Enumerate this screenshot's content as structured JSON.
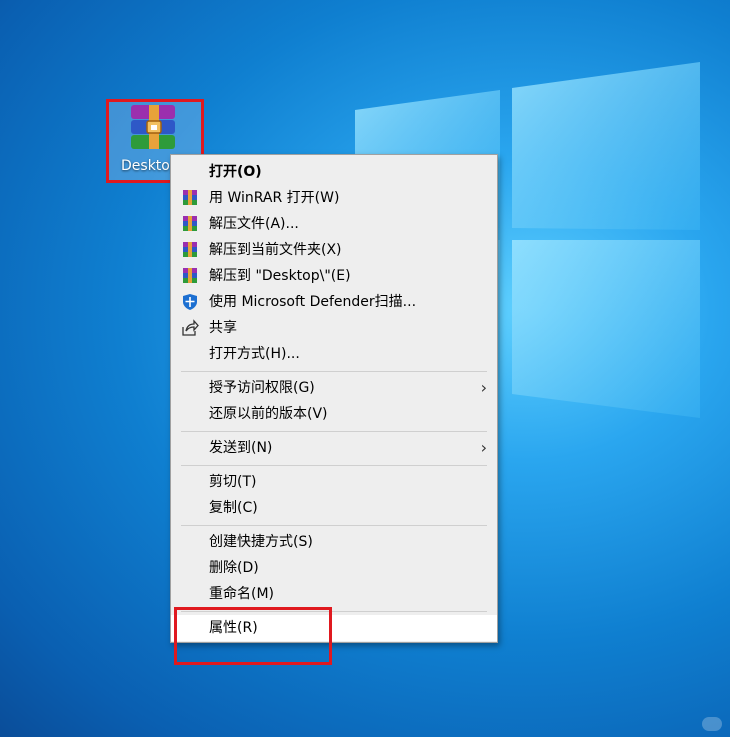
{
  "desktop": {
    "icon_label": "Desktop"
  },
  "menu": {
    "items": [
      {
        "label": "打开(O)",
        "bold": true,
        "icon": "none"
      },
      {
        "label": "用 WinRAR 打开(W)",
        "icon": "winrar-icon"
      },
      {
        "label": "解压文件(A)...",
        "icon": "winrar-icon"
      },
      {
        "label": "解压到当前文件夹(X)",
        "icon": "winrar-icon"
      },
      {
        "label": "解压到 \"Desktop\\\"(E)",
        "icon": "winrar-icon"
      },
      {
        "label": "使用 Microsoft Defender扫描...",
        "icon": "defender-shield-icon"
      },
      {
        "label": "共享",
        "icon": "share-icon"
      },
      {
        "label": "打开方式(H)...",
        "icon": "none"
      },
      {
        "label": "授予访问权限(G)",
        "icon": "none",
        "submenu": true
      },
      {
        "label": "还原以前的版本(V)",
        "icon": "none"
      },
      {
        "label": "发送到(N)",
        "icon": "none",
        "submenu": true
      },
      {
        "label": "剪切(T)",
        "icon": "none"
      },
      {
        "label": "复制(C)",
        "icon": "none"
      },
      {
        "label": "创建快捷方式(S)",
        "icon": "none"
      },
      {
        "label": "删除(D)",
        "icon": "none"
      },
      {
        "label": "重命名(M)",
        "icon": "none"
      },
      {
        "label": "属性(R)",
        "icon": "none",
        "highlighted": true
      }
    ],
    "submenu_arrow": "›"
  },
  "colors": {
    "highlight_box": "#e0191f",
    "menu_bg": "#eeeeee"
  }
}
